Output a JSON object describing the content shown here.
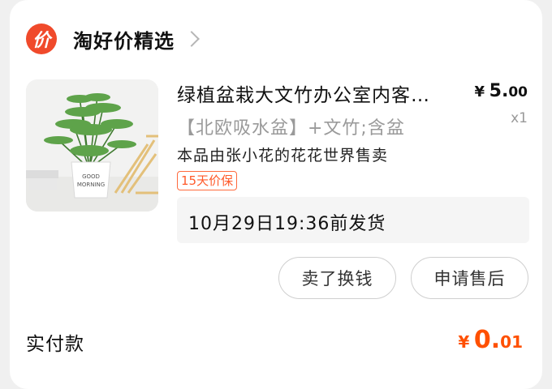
{
  "shop": {
    "logo_text": "价",
    "name": "淘好价精选"
  },
  "item": {
    "title": "绿植盆栽大文竹办公室内客…",
    "price": {
      "currency": "¥",
      "integer": "5.",
      "decimal": "00"
    },
    "quantity": "x1",
    "sku": "【北欧吸水盆】+文竹;含盆",
    "seller": "本品由张小花的花花世界售卖",
    "badge": "15天价保",
    "shipping": "10月29日19:36前发货",
    "image_text": [
      "GOOD",
      "MORNING"
    ]
  },
  "actions": {
    "sell_label": "卖了换钱",
    "after_sale_label": "申请售后"
  },
  "payment": {
    "label": "实付款",
    "currency": "¥",
    "integer": "0.",
    "decimal": "01"
  },
  "colors": {
    "accent": "#ff5000",
    "logo": "#f04a2b",
    "badge": "#ff5a2a"
  }
}
